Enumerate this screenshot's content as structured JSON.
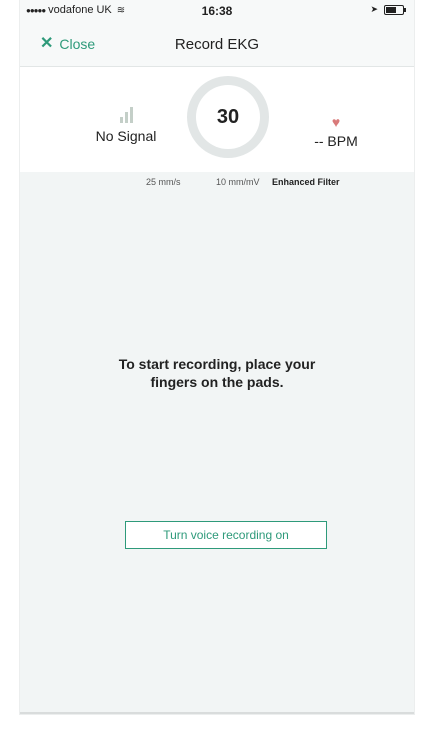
{
  "status_bar": {
    "signal_dots": "●●●●●",
    "carrier": "vodafone UK",
    "wifi_icon": "wifi-icon",
    "time": "16:38",
    "location_icon": "location-arrow-icon",
    "battery_icon": "battery-icon"
  },
  "nav": {
    "close_label": "Close",
    "title": "Record EKG"
  },
  "header": {
    "signal_label": "No Signal",
    "countdown": "30",
    "bpm_label": "-- BPM"
  },
  "settings": {
    "speed": "25 mm/s",
    "gain": "10 mm/mV",
    "filter": "Enhanced Filter"
  },
  "main": {
    "instruction": "To start recording, place your fingers on the pads.",
    "voice_button": "Turn voice recording on"
  },
  "colors": {
    "accent": "#2e9a7a",
    "heart": "#d97a7a",
    "background": "#f2f5f5"
  }
}
